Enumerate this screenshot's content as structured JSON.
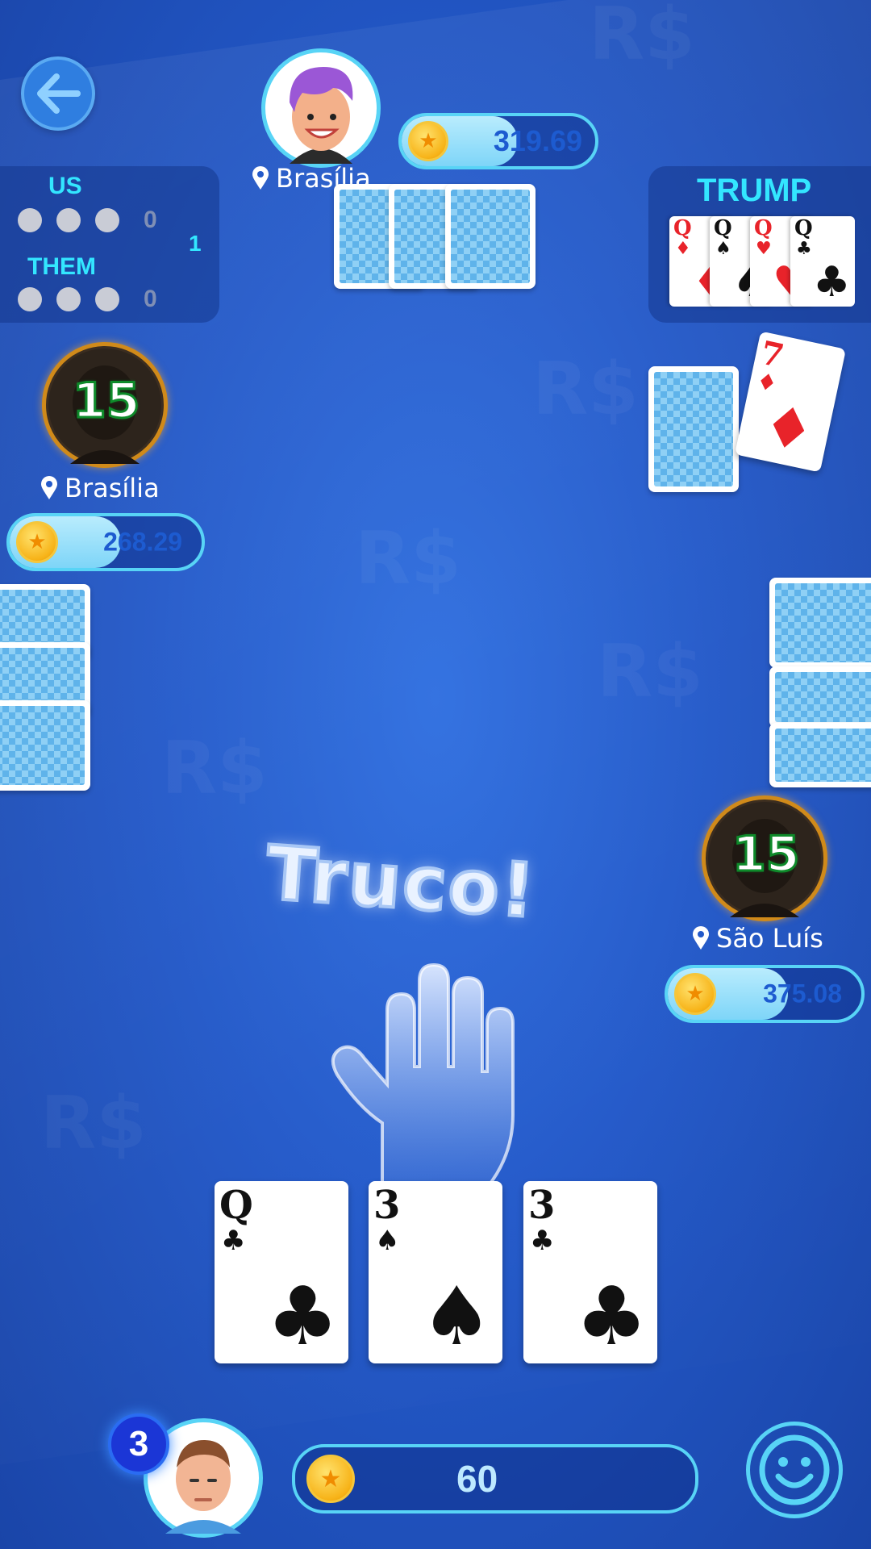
{
  "scoreboard": {
    "us_label": "US",
    "them_label": "THEM",
    "us_score": "0",
    "them_score": "0",
    "round": "1"
  },
  "trump": {
    "title": "TRUMP",
    "cards": [
      {
        "rank": "Q",
        "suit": "♦",
        "color": "#e8232a"
      },
      {
        "rank": "Q",
        "suit": "♠",
        "color": "#111111"
      },
      {
        "rank": "Q",
        "suit": "♥",
        "color": "#e8232a"
      },
      {
        "rank": "Q",
        "suit": "♣",
        "color": "#111111"
      }
    ],
    "vira": {
      "rank": "7",
      "suit": "♦",
      "color": "#e8232a"
    }
  },
  "players": {
    "top": {
      "location": "Brasília",
      "coins": "319.69"
    },
    "left": {
      "location": "Brasília",
      "coins": "268.29",
      "timer": "15"
    },
    "right": {
      "location": "São Luís",
      "coins": "375.08",
      "timer": "15"
    },
    "self": {
      "coins": "60",
      "badge": "3"
    }
  },
  "hand": [
    {
      "rank": "Q",
      "suit": "♣"
    },
    {
      "rank": "3",
      "suit": "♠"
    },
    {
      "rank": "3",
      "suit": "♣"
    }
  ],
  "call_text": "Truco!",
  "watermark": "R$",
  "colors": {
    "accent": "#33e6ff",
    "table": "#2359c9",
    "coin_pill_border": "#58d4f6"
  }
}
